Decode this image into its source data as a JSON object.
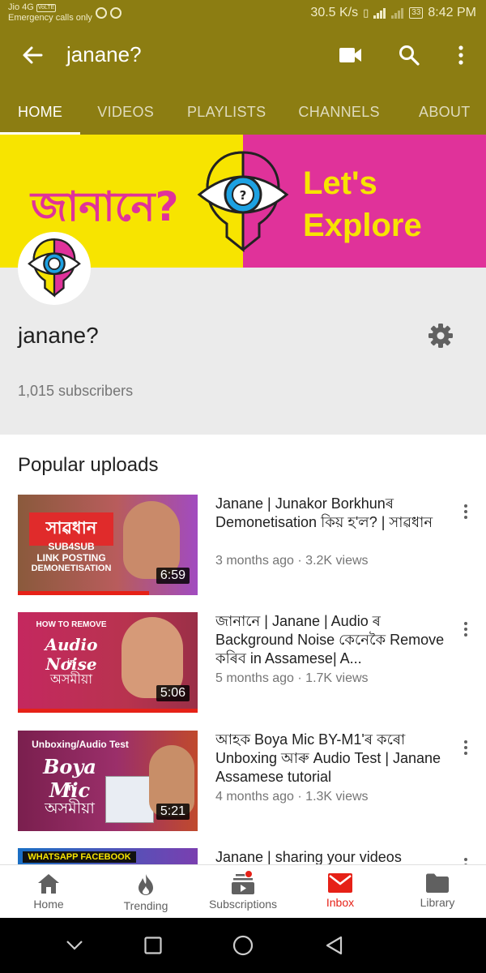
{
  "status_bar": {
    "carrier": "Jio 4G",
    "volte": "VoLTE",
    "emergency": "Emergency calls only",
    "net_speed": "30.5 K/s",
    "battery": "33",
    "time": "8:42 PM"
  },
  "app_bar": {
    "title": "janane?",
    "tabs": [
      "HOME",
      "VIDEOS",
      "PLAYLISTS",
      "CHANNELS",
      "ABOUT"
    ]
  },
  "banner": {
    "bengali_text": "জানানে?",
    "tagline_line1": "Let's",
    "tagline_line2": "Explore",
    "colors": {
      "yellow": "#f7e400",
      "pink": "#e0329a"
    }
  },
  "channel": {
    "name": "janane?",
    "subscribers": "1,015 subscribers"
  },
  "section_title": "Popular uploads",
  "videos": [
    {
      "title": "Janane | Junakor Borkhunৰ Demonetisation কিয় হ'ল? | সাৱধান",
      "meta": "3 months ago · 3.2K views",
      "duration": "6:59",
      "thumb_lines": [
        "সাৱধান",
        "SUB4SUB",
        "LINK POSTING",
        "DEMONETISATION"
      ],
      "watched": 0.73
    },
    {
      "title": "জানানে | Janane | Audio ৰ Background Noise কেনেকৈ Remove কৰিব in Assamese| A...",
      "meta": "5 months ago · 1.7K views",
      "duration": "5:06",
      "thumb_lines": [
        "HOW TO REMOVE",
        "Audio Noise",
        "in",
        "অসমীয়া"
      ],
      "watched": 1.0
    },
    {
      "title": "আহক Boya Mic BY-M1'ৰ কৰো Unboxing আৰু Audio Test | Janane Assamese tutorial",
      "meta": "4 months ago · 1.3K views",
      "duration": "5:21",
      "thumb_lines": [
        "Unboxing/Audio Test",
        "Boya Mic",
        "in",
        "অসমীয়া"
      ],
      "watched": 0
    },
    {
      "title": "Janane | sharing your videos",
      "meta": "",
      "duration": "",
      "thumb_lines": [
        "WHATSAPP FACEBOOK"
      ],
      "watched": 0
    }
  ],
  "bottom_nav": [
    "Home",
    "Trending",
    "Subscriptions",
    "Inbox",
    "Library"
  ],
  "icons": {
    "back": "arrow-left-icon",
    "video": "video-camera-icon",
    "search": "search-icon",
    "more": "more-vert-icon",
    "settings": "gear-icon"
  }
}
